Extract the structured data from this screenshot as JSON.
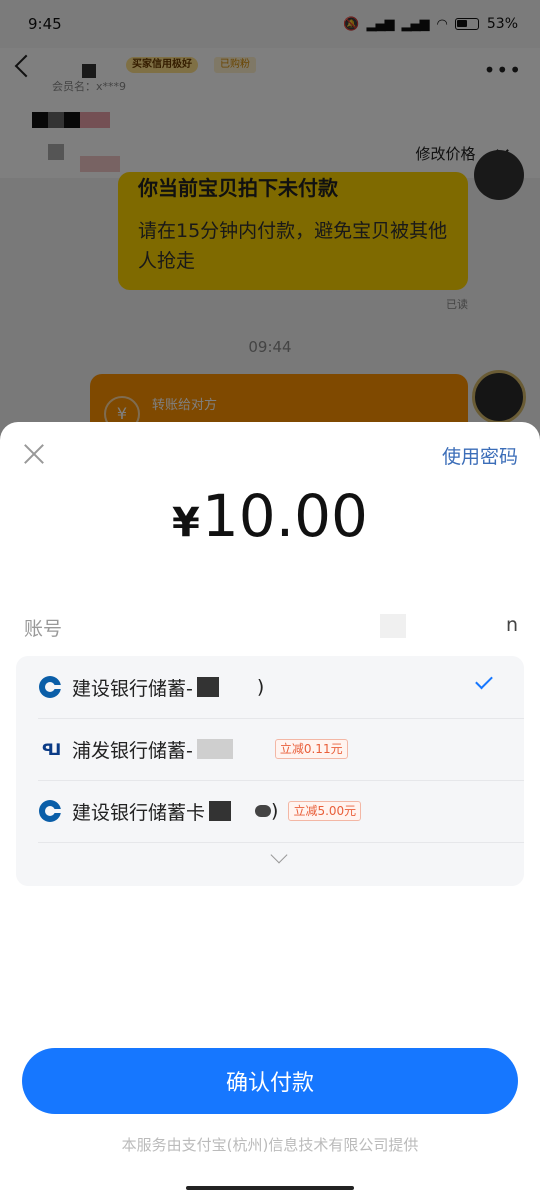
{
  "status_bar": {
    "time": "9:45",
    "battery": "53%"
  },
  "chat": {
    "member_prefix": "会员名：x***9",
    "badge_good": "买家信用极好",
    "badge_bought": "已购粉",
    "modify_price": "修改价格",
    "bubble_heading": "你当前宝贝拍下未付款",
    "bubble_text": "请在15分钟内付款，避免宝贝被其他人抢走",
    "read_status": "已读",
    "time_divider": "09:44",
    "transfer_label": "转账给对方"
  },
  "payment": {
    "use_password": "使用密码",
    "currency": "¥",
    "amount": "10.00",
    "account_label": "账号",
    "account_value_tail": "n",
    "methods": [
      {
        "name": "建设银行储蓄-",
        "suffix": ")",
        "discount": "",
        "selected": true,
        "icon": "ccb-bank-icon"
      },
      {
        "name": "浦发银行储蓄-",
        "suffix": "",
        "discount": "立减0.11元",
        "selected": false,
        "icon": "spdb-bank-icon"
      },
      {
        "name": "建设银行储蓄卡",
        "suffix": ")",
        "discount": "立减5.00元",
        "selected": false,
        "icon": "ccb-bank-icon"
      }
    ],
    "confirm_label": "确认付款",
    "footer_note": "本服务由支付宝(杭州)信息技术有限公司提供"
  },
  "colors": {
    "primary": "#1677ff",
    "password_link": "#3b6db8",
    "discount": "#e95f3a",
    "bubble_yellow": "#ffd400",
    "bubble_orange": "#ff9200"
  }
}
